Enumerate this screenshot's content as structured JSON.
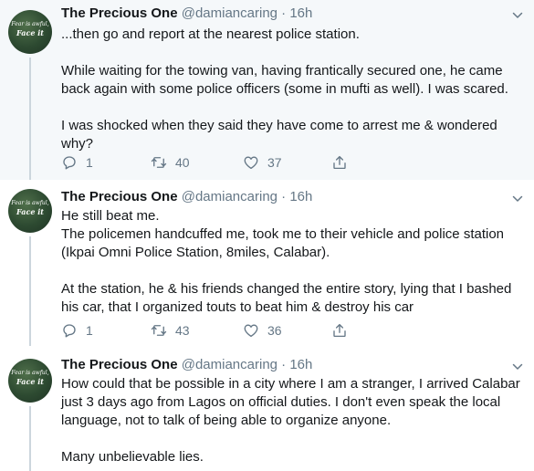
{
  "tweets": [
    {
      "avatar": {
        "line1": "Fear is awful,",
        "line2": "Face it"
      },
      "name": "The Precious One",
      "handle": "@damiancaring",
      "sep": "·",
      "time": "16h",
      "lines": [
        "...then go and report at the nearest police station.",
        "",
        "While waiting for the towing van, having frantically secured one, he came",
        "back again with some police officers (some in mufti as well). I was scared.",
        "",
        "I was shocked when they said they have come to arrest me & wondered",
        "why?"
      ],
      "replies": "1",
      "retweets": "40",
      "likes": "37"
    },
    {
      "avatar": {
        "line1": "Fear is awful,",
        "line2": "Face it"
      },
      "name": "The Precious One",
      "handle": "@damiancaring",
      "sep": "·",
      "time": "16h",
      "lines": [
        "He still beat me.",
        "The policemen handcuffed me, took me to their vehicle and police station",
        "(Ikpai Omni Police Station, 8miles, Calabar).",
        "",
        "At the station, he & his friends changed the entire story, lying that I bashed",
        "his car, that I organized touts to beat him & destroy his car"
      ],
      "replies": "1",
      "retweets": "43",
      "likes": "36"
    },
    {
      "avatar": {
        "line1": "Fear is awful,",
        "line2": "Face it"
      },
      "name": "The Precious One",
      "handle": "@damiancaring",
      "sep": "·",
      "time": "16h",
      "lines": [
        "How could that be possible in a city where I am a stranger, I arrived Calabar",
        "just 3 days ago from Lagos on official duties. I don't even speak the local",
        "language, not to talk of being able to organize anyone.",
        "",
        "Many unbelievable lies."
      ]
    }
  ],
  "colors": {
    "text": "#14171a",
    "muted": "#657786",
    "highlight_bg": "#f5f8fa",
    "thread_line": "#ccd6dd",
    "divider": "#e6ecf0"
  },
  "icons": [
    "reply-icon",
    "retweet-icon",
    "like-icon",
    "share-icon",
    "chevron-down-icon"
  ]
}
